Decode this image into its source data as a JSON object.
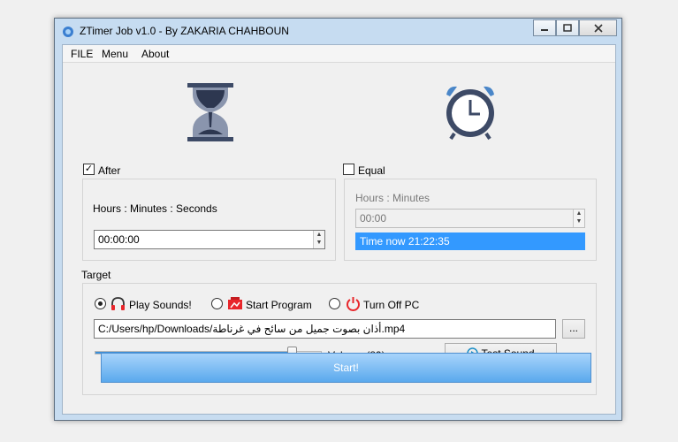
{
  "window": {
    "title": "ZTimer Job v1.0 - By ZAKARIA CHAHBOUN"
  },
  "menu": [
    "FILE",
    "Menu",
    "About"
  ],
  "after": {
    "label": "After",
    "checked": true,
    "format_label": "Hours : Minutes : Seconds",
    "value": "00:00:00"
  },
  "equal": {
    "label": "Equal",
    "checked": false,
    "format_label": "Hours : Minutes",
    "value": "00:00",
    "time_now": "Time now 21:22:35"
  },
  "target": {
    "label": "Target",
    "options": [
      "Play Sounds!",
      "Start Program",
      "Turn Off PC"
    ],
    "selected": "Play Sounds!",
    "file_path": "C:/Users/hp/Downloads/أذان بصوت جميل من سائح في غرناطة.mp4",
    "browse_label": "...",
    "volume_label": "Volume (89)",
    "volume_level": 0.89,
    "test_sound_label": "Test Sound",
    "start_label": "Start!"
  },
  "colors": {
    "accent": "#3399ff",
    "start_top": "#a8d4fb",
    "start_bottom": "#5aa9ed",
    "icon_dark": "#3d4a66",
    "turnoff_red": "#e8262b"
  }
}
